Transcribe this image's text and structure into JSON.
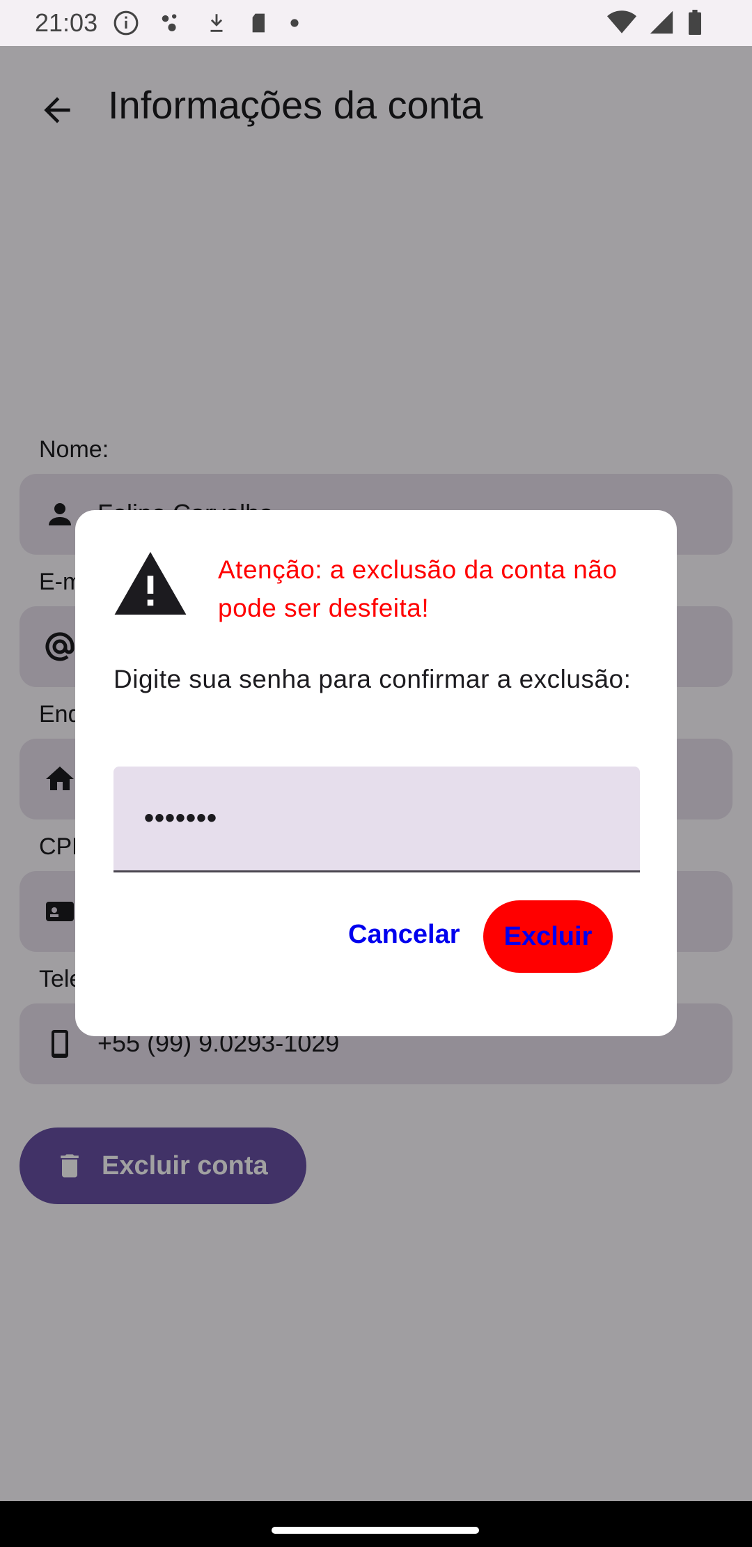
{
  "status_bar": {
    "time": "21:03"
  },
  "app_bar": {
    "title": "Informações da conta"
  },
  "form": {
    "name_label": "Nome:",
    "name_value": "Felipe Carvalho",
    "email_label": "E-mail:",
    "address_label": "Endereço:",
    "cpf_label": "CPF:",
    "phone_label": "Telefone:",
    "phone_value": "+55 (99) 9.0293-1029"
  },
  "delete_account_button": "Excluir conta",
  "dialog": {
    "warning": "Atenção: a exclusão da conta não pode ser desfeita!",
    "prompt": "Digite sua senha para confirmar a exclusão:",
    "password_value": "•••••••",
    "cancel_label": "Cancelar",
    "confirm_label": "Excluir"
  },
  "colors": {
    "warning_text": "#ff0000",
    "confirm_bg": "#ff0000",
    "button_text": "#0000ee",
    "primary": "#6750a4"
  }
}
